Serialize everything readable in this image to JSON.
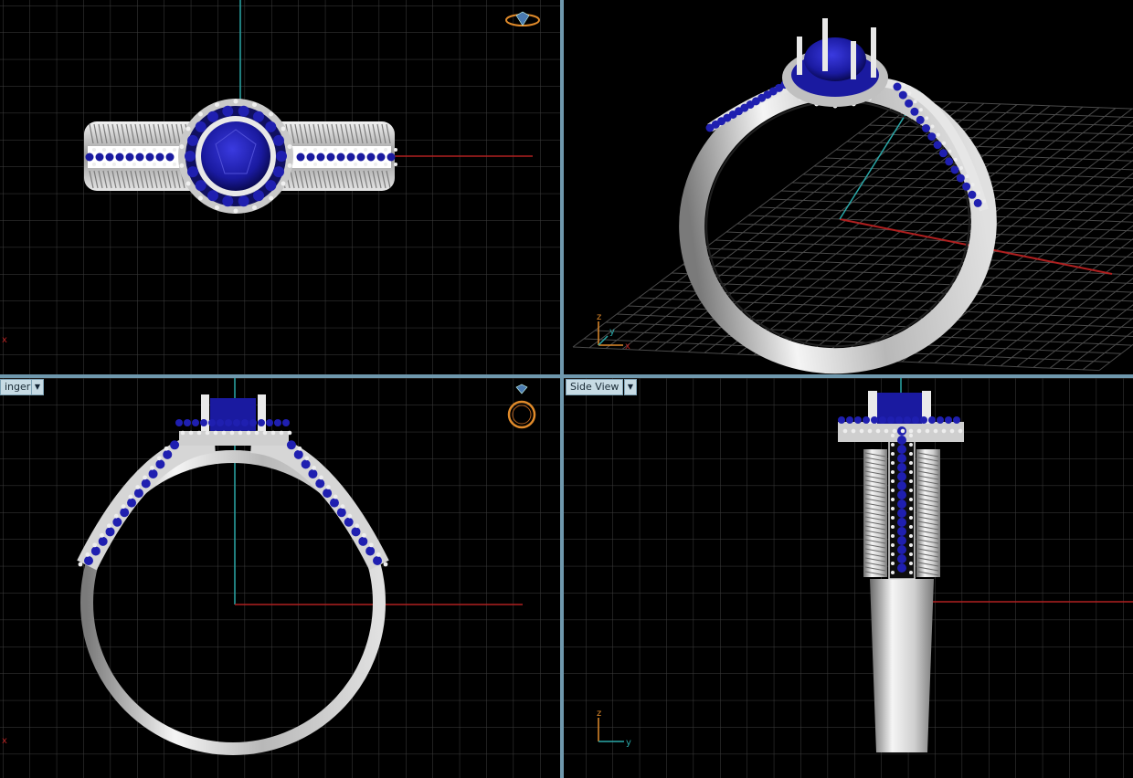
{
  "viewports": {
    "top": {
      "axis_label": "x"
    },
    "persp": {
      "axis_z": "z",
      "axis_y": "y",
      "axis_x": "x"
    },
    "front": {
      "label": "inger",
      "axis_label": "x"
    },
    "side": {
      "label": "Side View",
      "axis_z": "z",
      "axis_y": "y"
    }
  },
  "colors": {
    "background": "#000000",
    "grid": "#3f3f3f",
    "axis_x": "#b02020",
    "axis_y": "#2aa8a8",
    "metal": "#d8d8d8",
    "gem": "#1a1aa0",
    "divider": "#6f98ad",
    "label_bg": "#c7dbe4",
    "compass": "#e08a2a"
  }
}
